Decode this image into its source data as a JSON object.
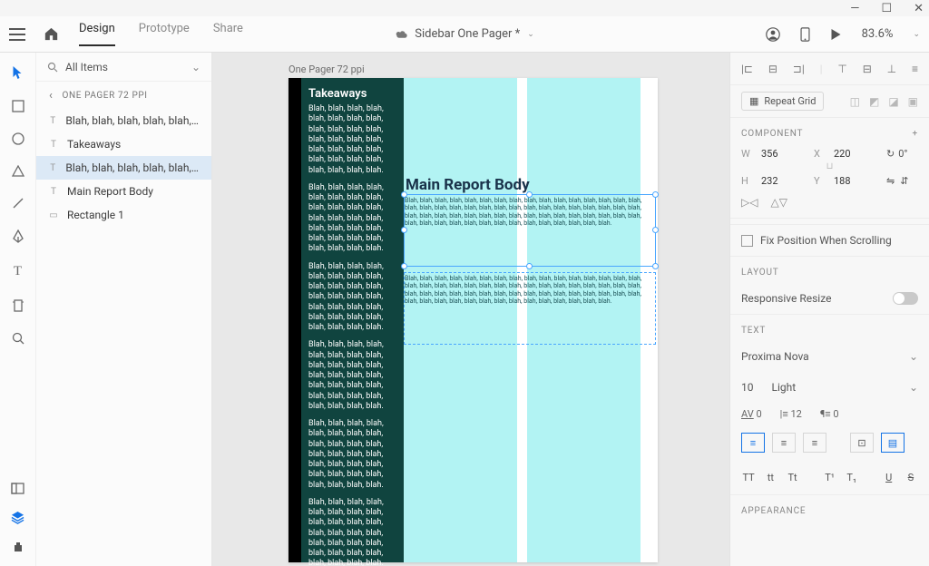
{
  "window": {
    "min": "—",
    "max": "☐",
    "close": "✕"
  },
  "topbar": {
    "tabs": {
      "design": "Design",
      "prototype": "Prototype",
      "share": "Share"
    },
    "doc": "Sidebar One Pager *",
    "zoom": "83.6%"
  },
  "layers": {
    "filter": "All Items",
    "crumb": "ONE PAGER 72 PPI",
    "items": [
      {
        "ico": "T",
        "label": "Blah, blah, blah, blah, blah, blah,…"
      },
      {
        "ico": "T",
        "label": "Takeaways"
      },
      {
        "ico": "T",
        "label": "Blah, blah, blah, blah, blah, blah,…",
        "sel": true
      },
      {
        "ico": "T",
        "label": "Main Report Body"
      },
      {
        "ico": "▭",
        "label": "Rectangle 1"
      }
    ]
  },
  "canvas": {
    "artboard_label": "One Pager 72 ppi",
    "sidebar": {
      "title": "Takeaways",
      "para": "Blah, blah, blah, blah, blah, blah, blah, blah, blah, blah, blah, blah, blah, blah, blah, blah, blah, blah, blah, blah, blah, blah, blah, blah, blah, blah, blah, blah."
    },
    "main": {
      "title": "Main Report Body",
      "para": "Blah, blah, blah, blah, blah, blah, blah, blah, blah, blah, blah, blah, blah, blah, blah, blah, blah, blah, blah, blah, blah, blah, blah, blah, blah, blah, blah, blah, blah, blah, blah, blah, blah, blah, blah, blah, blah, blah, blah, blah, blah, blah, blah, blah, blah, blah, blah, blah, blah, blah, blah, blah, blah, blah, blah, blah, blah, blah, blah, blah, blah, blah."
    }
  },
  "props": {
    "repeat": "Repeat Grid",
    "component": "COMPONENT",
    "w": "356",
    "x": "220",
    "rot": "0°",
    "h": "232",
    "y": "188",
    "fix": "Fix Position When Scrolling",
    "layout": "LAYOUT",
    "responsive": "Responsive Resize",
    "text": "TEXT",
    "font": "Proxima Nova",
    "size": "10",
    "weight": "Light",
    "charspace": "0",
    "lineheight": "12",
    "paraspace": "0",
    "appearance": "APPEARANCE"
  }
}
